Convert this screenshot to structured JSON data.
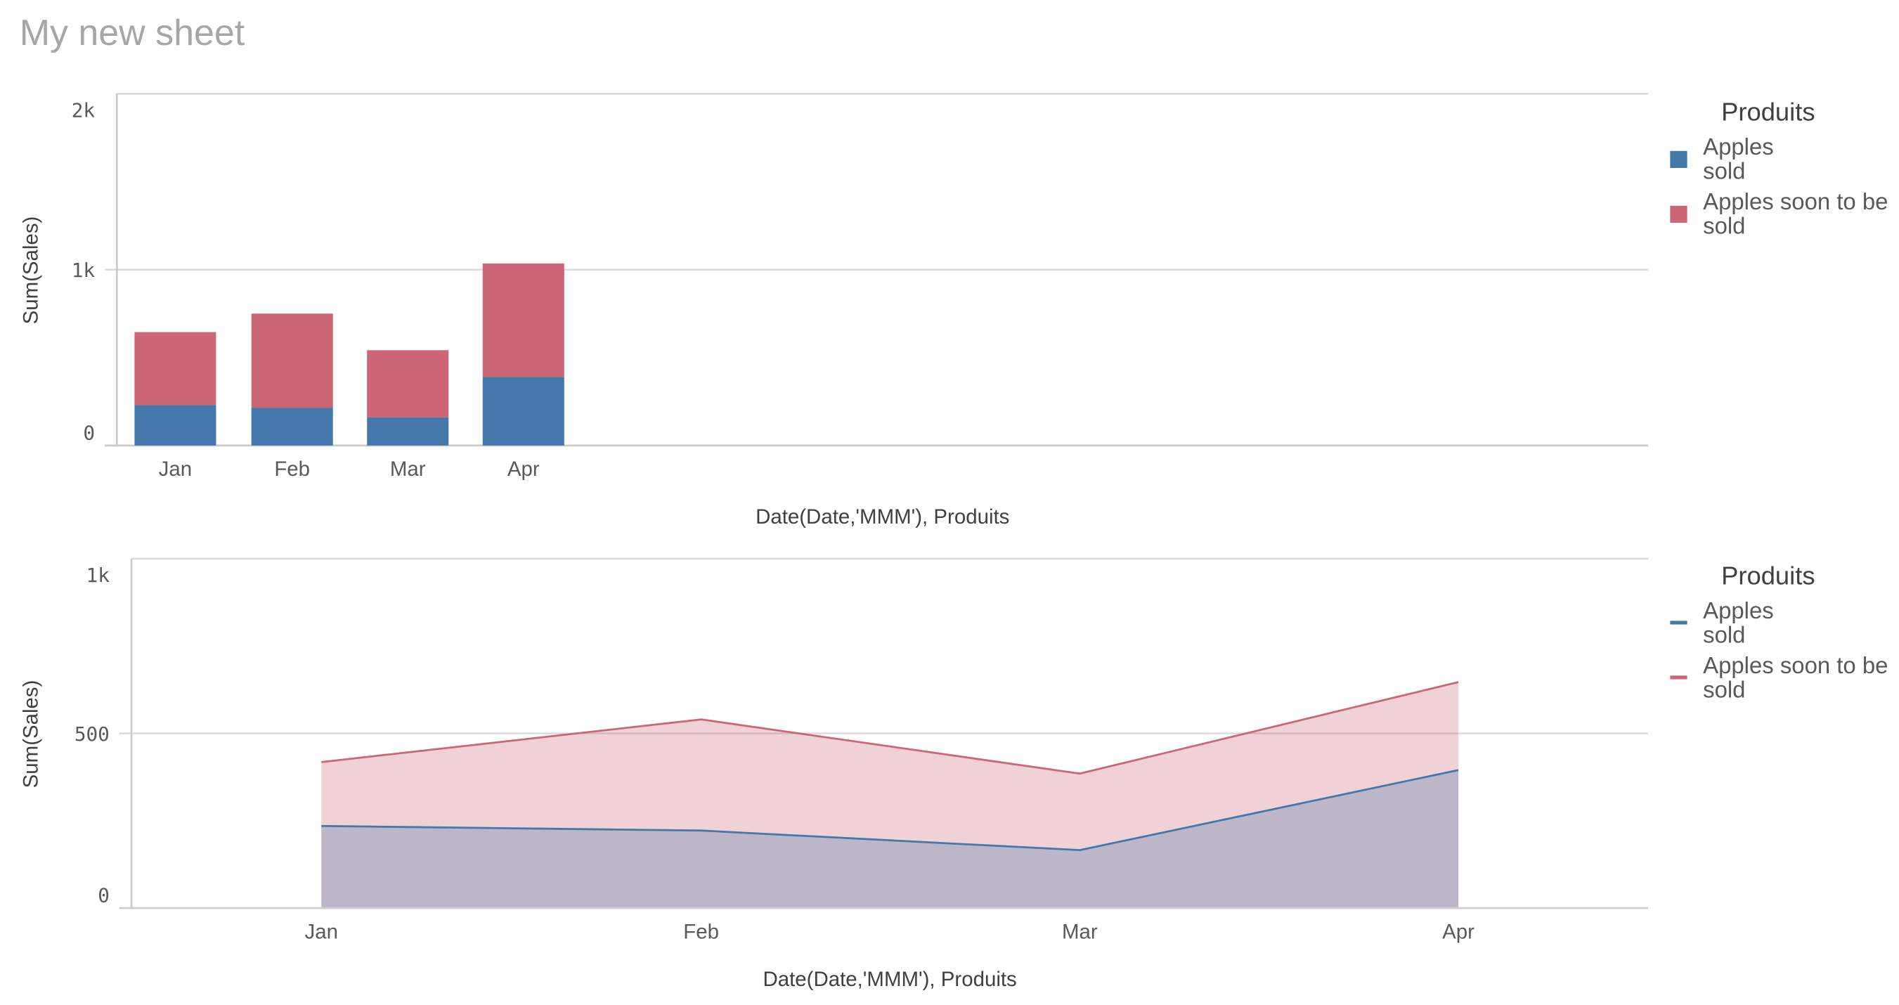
{
  "sheet": {
    "title": "My new sheet"
  },
  "colors": {
    "apples_sold": "#4477aa",
    "apples_soon": "#cc6677"
  },
  "chart_data": [
    {
      "type": "bar",
      "stacked": true,
      "categories": [
        "Jan",
        "Feb",
        "Mar",
        "Apr"
      ],
      "series": [
        {
          "name": "Apples sold",
          "values": [
            230,
            215,
            160,
            390
          ]
        },
        {
          "name": "Apples soon to be sold",
          "values": [
            415,
            535,
            382,
            645
          ]
        }
      ],
      "xlabel": "Date(Date,'MMM'),  Produits",
      "ylabel": "Sum(Sales)",
      "ylim": [
        0,
        2000
      ],
      "yticks": [
        {
          "value": 2000,
          "label": "2k"
        },
        {
          "value": 1000,
          "label": "1k"
        },
        {
          "value": 0,
          "label": "0"
        }
      ],
      "grid": true,
      "legend": {
        "title": "Produits",
        "placement": "right",
        "items": [
          [
            "Apples",
            "sold"
          ],
          [
            "Apples soon to be",
            "sold"
          ]
        ]
      }
    },
    {
      "type": "area",
      "stacked": false,
      "categories": [
        "Jan",
        "Feb",
        "Mar",
        "Apr"
      ],
      "series": [
        {
          "name": "Apples sold",
          "values": [
            235,
            222,
            166,
            395
          ]
        },
        {
          "name": "Apples soon to be sold",
          "values": [
            418,
            540,
            385,
            647
          ]
        }
      ],
      "xlabel": "Date(Date,'MMM'),  Produits",
      "ylabel": "Sum(Sales)",
      "ylim": [
        0,
        1000
      ],
      "yticks": [
        {
          "value": 1000,
          "label": "1k"
        },
        {
          "value": 500,
          "label": "500"
        },
        {
          "value": 0,
          "label": "0"
        }
      ],
      "grid": true,
      "legend": {
        "title": "Produits",
        "placement": "right",
        "items": [
          [
            "Apples",
            "sold"
          ],
          [
            "Apples soon to be",
            "sold"
          ]
        ]
      }
    }
  ]
}
